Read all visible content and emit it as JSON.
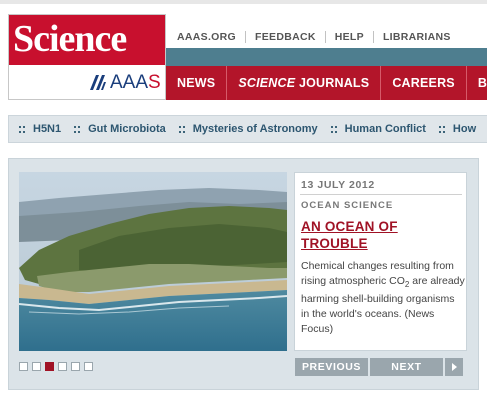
{
  "brand": {
    "logo": "Science",
    "org_prefix": "AAA",
    "org_suffix": "S"
  },
  "utility_links": [
    "AAAS.ORG",
    "FEEDBACK",
    "HELP",
    "LIBRARIANS"
  ],
  "nav": {
    "news": "NEWS",
    "journals_em": "SCIENCE",
    "journals_rest": " JOURNALS",
    "careers": "CAREERS",
    "blogs": "BLO"
  },
  "topics": [
    "H5N1",
    "Gut Microbiota",
    "Mysteries of Astronomy",
    "Human Conflict",
    "How"
  ],
  "feature": {
    "date": "13 JULY 2012",
    "kicker": "OCEAN SCIENCE",
    "title": "AN OCEAN OF TROUBLE",
    "desc_before": "Chemical changes resulting from rising atmospheric CO",
    "desc_sub": "2",
    "desc_after": " are already harming shell-building organisms in the world's oceans. (News Focus)",
    "slide_count": 6,
    "active_slide": 3
  },
  "pager": {
    "previous": "PREVIOUS",
    "next": "NEXT"
  },
  "colors": {
    "brand_red": "#c8102e",
    "nav_red": "#b3152a",
    "teal": "#4e7e8f",
    "headline_red": "#a01225"
  },
  "icons": [
    "aaas-logo-mark-icon",
    "topic-grip-icon",
    "play-arrow-icon"
  ]
}
